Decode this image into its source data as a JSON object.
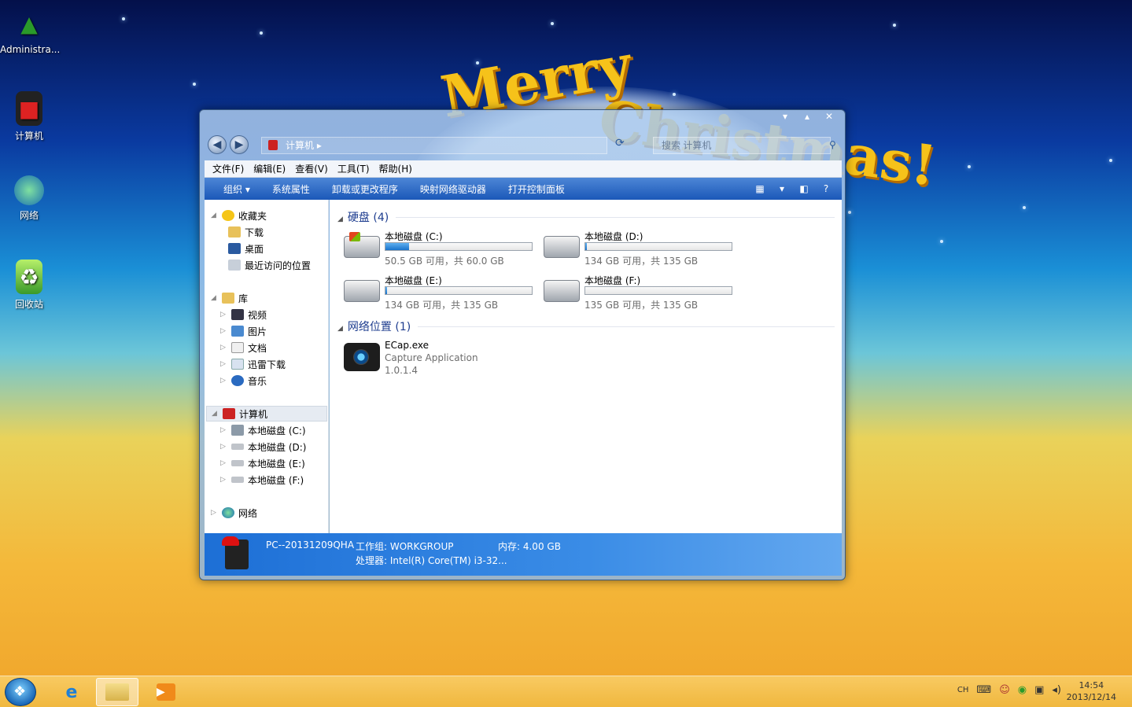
{
  "watermark": "",
  "desktop": {
    "icons": [
      {
        "label": "Administra..."
      },
      {
        "label": "计算机"
      },
      {
        "label": "网络"
      },
      {
        "label": "回收站"
      }
    ]
  },
  "window": {
    "address": {
      "path": "计算机"
    },
    "search": {
      "placeholder": "搜索 计算机"
    },
    "menu": [
      "文件(F)",
      "编辑(E)",
      "查看(V)",
      "工具(T)",
      "帮助(H)"
    ],
    "toolbar": [
      "组织 ▾",
      "系统属性",
      "卸载或更改程序",
      "映射网络驱动器",
      "打开控制面板"
    ],
    "nav": {
      "favorites": "收藏夹",
      "fav_items": [
        "下载",
        "桌面",
        "最近访问的位置"
      ],
      "libraries": "库",
      "lib_items": [
        "视频",
        "图片",
        "文档",
        "迅雷下载",
        "音乐"
      ],
      "computer": "计算机",
      "drive_items": [
        "本地磁盘 (C:)",
        "本地磁盘 (D:)",
        "本地磁盘 (E:)",
        "本地磁盘 (F:)"
      ],
      "network": "网络"
    },
    "groups": {
      "drives_title": "硬盘 (4)",
      "network_title": "网络位置 (1)"
    },
    "drives": [
      {
        "name": "本地磁盘 (C:)",
        "info": "50.5 GB 可用，共 60.0 GB",
        "used_fraction": 0.16
      },
      {
        "name": "本地磁盘 (D:)",
        "info": "134 GB 可用，共 135 GB",
        "used_fraction": 0.01
      },
      {
        "name": "本地磁盘 (E:)",
        "info": "134 GB 可用，共 135 GB",
        "used_fraction": 0.01
      },
      {
        "name": "本地磁盘 (F:)",
        "info": "135 GB 可用，共 135 GB",
        "used_fraction": 0.0
      }
    ],
    "network_item": {
      "name": "ECap.exe",
      "desc": "Capture Application",
      "version": "1.0.1.4"
    },
    "details": {
      "pc_name": "PC--20131209QHA",
      "workgroup": "工作组: WORKGROUP",
      "memory": "内存: 4.00 GB",
      "cpu": "处理器: Intel(R) Core(TM) i3-32..."
    }
  },
  "taskbar": {
    "tray_lang": "CH",
    "time": "14:54",
    "date": "2013/12/14"
  }
}
